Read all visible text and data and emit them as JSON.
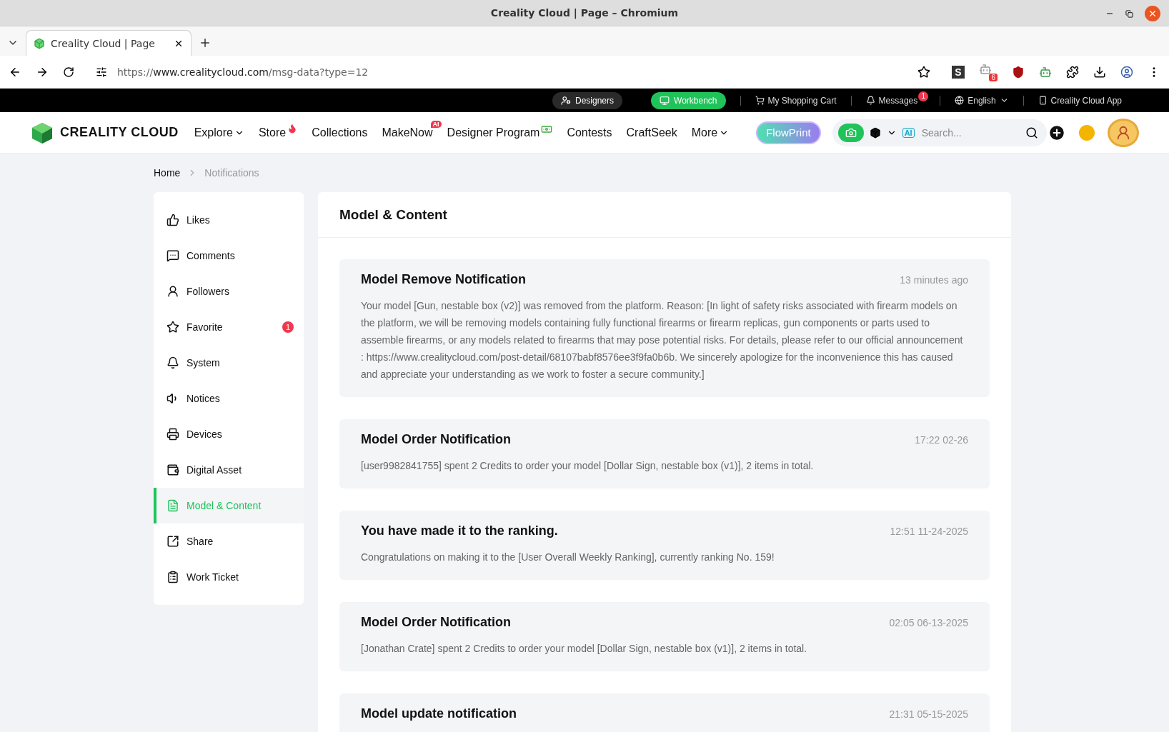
{
  "browser": {
    "window_title": "Creality Cloud | Page – Chromium",
    "tab_title": "Creality Cloud | Page",
    "url": {
      "scheme": "https://",
      "host": "www.crealitycloud.com",
      "path": "/msg-data?type=12"
    },
    "extension_badge": "6",
    "extension_letter": "S"
  },
  "top_bar": {
    "items": [
      {
        "kind": "dark-pill",
        "label": "Designers"
      },
      {
        "kind": "green-pill",
        "label": "Workbench"
      },
      {
        "kind": "cart",
        "label": "My Shopping Cart"
      },
      {
        "kind": "messages",
        "label": "Messages",
        "badge": "1"
      },
      {
        "kind": "language",
        "label": "English"
      },
      {
        "kind": "app",
        "label": "Creality Cloud App"
      }
    ]
  },
  "header": {
    "logo_text": "CREALITY CLOUD",
    "nav": [
      {
        "label": "Explore",
        "kind": "dropdown"
      },
      {
        "label": "Store",
        "kind": "fire"
      },
      {
        "label": "Collections",
        "kind": "plain"
      },
      {
        "label": "MakeNow",
        "kind": "ai",
        "tag": "AI"
      },
      {
        "label": "Designer Program",
        "kind": "money"
      },
      {
        "label": "Contests",
        "kind": "plain"
      },
      {
        "label": "CraftSeek",
        "kind": "plain"
      },
      {
        "label": "More",
        "kind": "dropdown"
      }
    ],
    "flowprint": "FlowPrint",
    "search": {
      "ai_tag": "AI",
      "placeholder": "Search..."
    }
  },
  "breadcrumb": [
    {
      "label": "Home",
      "current": false
    },
    {
      "label": "Notifications",
      "current": true
    }
  ],
  "sidebar": {
    "items": [
      {
        "label": "Likes",
        "selected": false
      },
      {
        "label": "Comments",
        "selected": false
      },
      {
        "label": "Followers",
        "selected": false
      },
      {
        "label": "Favorite",
        "selected": false,
        "badge": "1"
      },
      {
        "label": "System",
        "selected": false
      },
      {
        "label": "Notices",
        "selected": false
      },
      {
        "label": "Devices",
        "selected": false
      },
      {
        "label": "Digital Asset",
        "selected": false
      },
      {
        "label": "Model & Content",
        "selected": true
      },
      {
        "label": "Share",
        "selected": false
      },
      {
        "label": "Work Ticket",
        "selected": false
      }
    ]
  },
  "panel": {
    "title": "Model & Content",
    "notifications": [
      {
        "title": "Model Remove Notification",
        "time": "13 minutes ago",
        "body": "Your model [Gun, nestable box (v2)] was removed from the platform. Reason: [In light of safety risks associated with firearm models on the platform, we will be removing models containing fully functional firearms or firearm replicas, gun components or parts used to assemble firearms, or any models related to firearms that may pose potential risks. For details, please refer to our official announcement : https://www.crealitycloud.com/post-detail/68107babf8576ee3f9fa0b6b. We sincerely apologize for the inconvenience this has caused and appreciate your understanding as we work to foster a secure community.]"
      },
      {
        "title": "Model Order Notification",
        "time": "17:22 02-26",
        "body": "[user9982841755] spent 2 Credits to order your model [Dollar Sign, nestable box (v1)], 2 items in total."
      },
      {
        "title": "You have made it to the ranking.",
        "time": "12:51 11-24-2025",
        "body": "Congratulations on making it to the [User Overall Weekly Ranking], currently ranking No. 159!"
      },
      {
        "title": "Model Order Notification",
        "time": "02:05 06-13-2025",
        "body": "[Jonathan Crate] spent 2 Credits to order your model [Dollar Sign, nestable box (v1)], 2 items in total."
      },
      {
        "title": "Model update notification",
        "time": "21:31 05-15-2025"
      }
    ]
  }
}
